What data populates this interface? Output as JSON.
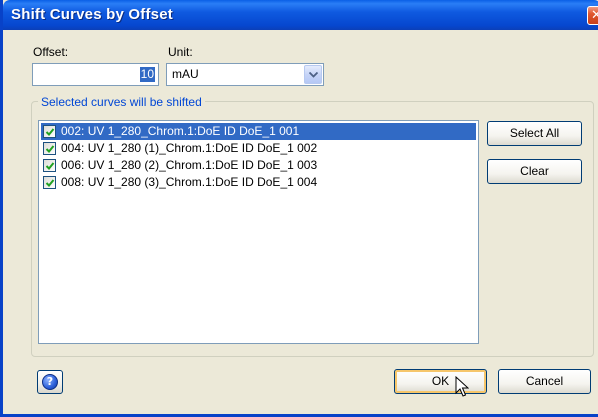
{
  "window": {
    "title": "Shift Curves by Offset",
    "close_glyph": "✕"
  },
  "offset": {
    "label": "Offset:",
    "value": "10"
  },
  "unit": {
    "label": "Unit:",
    "selected": "mAU"
  },
  "curves_group": {
    "legend": "Selected curves will be shifted",
    "items": [
      {
        "label": "002: UV 1_280_Chrom.1:DoE ID DoE_1 001",
        "checked": true,
        "selected": true
      },
      {
        "label": "004: UV 1_280 (1)_Chrom.1:DoE ID DoE_1 002",
        "checked": true,
        "selected": false
      },
      {
        "label": "006: UV 1_280 (2)_Chrom.1:DoE ID DoE_1 003",
        "checked": true,
        "selected": false
      },
      {
        "label": "008: UV 1_280 (3)_Chrom.1:DoE ID DoE_1 004",
        "checked": true,
        "selected": false
      }
    ],
    "select_all_label": "Select All",
    "clear_label": "Clear"
  },
  "footer": {
    "help_glyph": "?",
    "ok_label": "OK",
    "cancel_label": "Cancel"
  },
  "colors": {
    "titlebar": "#0a5fe6",
    "selection": "#316ac5",
    "legend_text": "#0046d5",
    "dialog_bg": "#ece9d8"
  },
  "icons": [
    "close-icon",
    "dropdown-arrow-icon",
    "checkbox-checked-icon",
    "help-icon",
    "mouse-pointer-icon"
  ]
}
